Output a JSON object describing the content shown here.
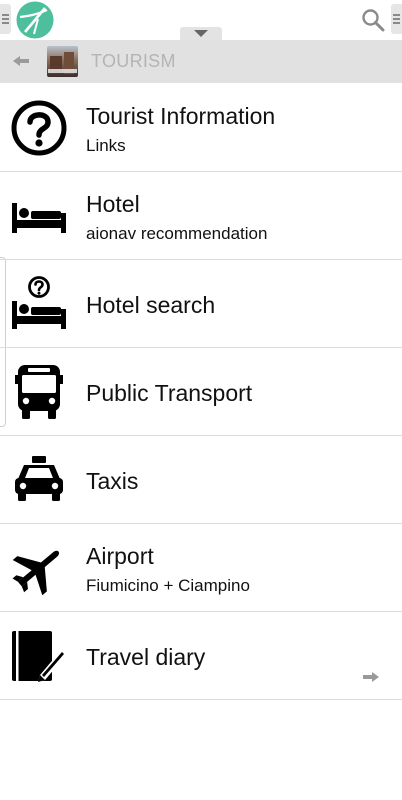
{
  "header": {
    "category_title": "TOURISM"
  },
  "items": [
    {
      "title": "Tourist Information",
      "subtitle": "Links",
      "icon": "question-circle-icon"
    },
    {
      "title": "Hotel",
      "subtitle": "aionav recommendation",
      "icon": "bed-icon"
    },
    {
      "title": "Hotel search",
      "subtitle": "",
      "icon": "bed-question-icon"
    },
    {
      "title": "Public Transport",
      "subtitle": "",
      "icon": "bus-icon"
    },
    {
      "title": "Taxis",
      "subtitle": "",
      "icon": "taxi-icon"
    },
    {
      "title": "Airport",
      "subtitle": "Fiumicino + Ciampino",
      "icon": "airplane-icon"
    },
    {
      "title": "Travel diary",
      "subtitle": "",
      "icon": "notebook-pen-icon"
    }
  ],
  "colors": {
    "logo": "#4dbf9c",
    "category_bar": "#e1e1e1",
    "divider": "#dcdcdc"
  }
}
